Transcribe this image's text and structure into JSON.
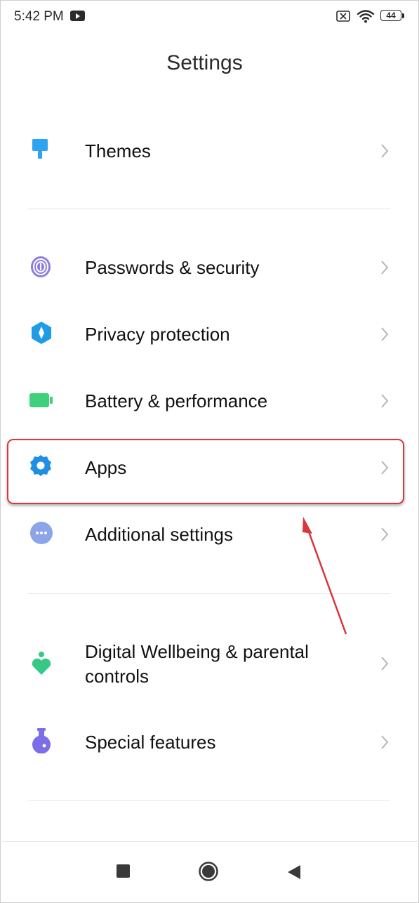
{
  "status_bar": {
    "time": "5:42 PM",
    "notification_icon": "youtube-icon",
    "sim_icon": "no-sim-icon",
    "wifi_icon": "wifi-icon",
    "battery_level": "44"
  },
  "header": {
    "title": "Settings"
  },
  "settings": {
    "items": [
      {
        "label": "Themes",
        "icon": "paintbrush-icon",
        "color": "#2ea3f2"
      },
      {
        "label": "Passwords & security",
        "icon": "fingerprint-icon",
        "color": "#8c7ee0"
      },
      {
        "label": "Privacy protection",
        "icon": "privacy-shield-icon",
        "color": "#1f9ce8"
      },
      {
        "label": "Battery & performance",
        "icon": "battery-icon",
        "color": "#3ed17a"
      },
      {
        "label": "Apps",
        "icon": "gear-icon",
        "color": "#1f8fe6"
      },
      {
        "label": "Additional settings",
        "icon": "more-dots-icon",
        "color": "#8ba4ea"
      },
      {
        "label": "Digital Wellbeing & parental controls",
        "label_line1": "Digital Wellbeing & parental",
        "label_line2": "controls",
        "icon": "wellbeing-heart-icon",
        "color": "#36c986"
      },
      {
        "label": "Special features",
        "icon": "flask-icon",
        "color": "#7b6ee8"
      }
    ]
  },
  "annotation": {
    "highlight_color": "#d9363e",
    "highlighted_item": "Apps"
  },
  "nav_bar": {
    "recents_icon": "recents-square-icon",
    "home_icon": "home-circle-icon",
    "back_icon": "back-triangle-icon"
  }
}
